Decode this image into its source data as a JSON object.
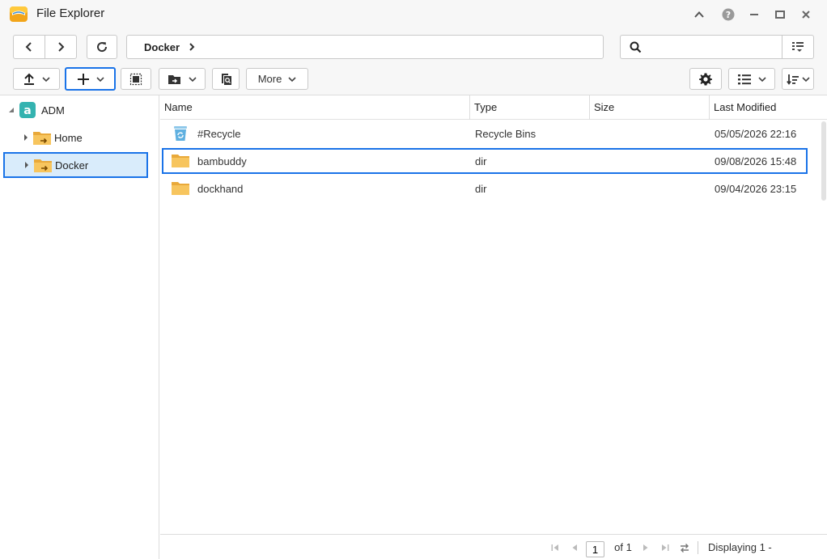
{
  "window": {
    "title": "File Explorer"
  },
  "navigation": {
    "path": "Docker"
  },
  "search": {
    "value": "",
    "placeholder": ""
  },
  "toolbar": {
    "more_label": "More"
  },
  "sidebar": {
    "root": {
      "label": "ADM"
    },
    "items": [
      {
        "label": "Home"
      },
      {
        "label": "Docker"
      }
    ]
  },
  "table": {
    "columns": [
      "Name",
      "Type",
      "Size",
      "Last Modified"
    ],
    "rows": [
      {
        "name": "#Recycle",
        "type": "Recycle Bins",
        "size": "",
        "modified": "05/05/2026 22:16",
        "icon": "recycle-bin-icon"
      },
      {
        "name": "bambuddy",
        "type": "dir",
        "size": "",
        "modified": "09/08/2026 15:48",
        "icon": "folder-icon"
      },
      {
        "name": "dockhand",
        "type": "dir",
        "size": "",
        "modified": "09/04/2026 23:15",
        "icon": "folder-icon"
      }
    ]
  },
  "pagination": {
    "page": "1",
    "of_label": "of 1",
    "display_text": "Displaying 1 -"
  },
  "colors": {
    "accent": "#1a73e8",
    "folder": "#f7c55e",
    "selection_fill": "#d9ecfb",
    "adm_logo": "#34b3b0"
  }
}
